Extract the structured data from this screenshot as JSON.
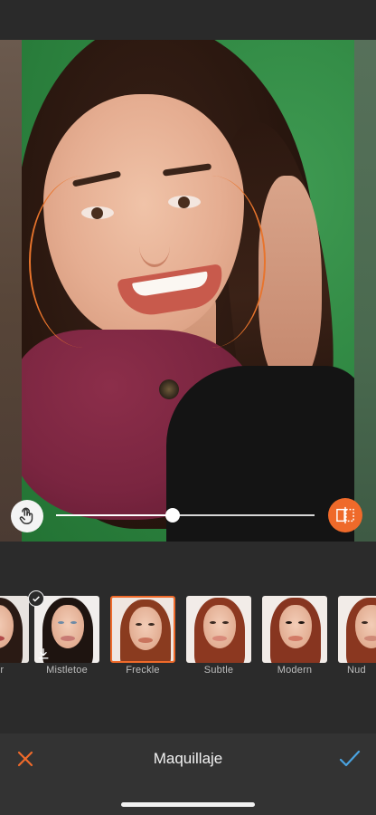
{
  "app": {
    "title": "Maquillaje"
  },
  "slider": {
    "value_fraction": 0.45
  },
  "colors": {
    "accent": "#ef6a2a",
    "confirm": "#4aa3e0",
    "background": "#2b2b2b"
  },
  "icons": {
    "touch": "touch-hand-icon",
    "compare": "compare-split-icon",
    "close": "close-icon",
    "confirm": "check-icon",
    "selected_badge": "check-circle-icon",
    "download": "download-icon"
  },
  "makeup_styles": [
    {
      "label": "der",
      "selected": false
    },
    {
      "label": "Mistletoe",
      "selected": false
    },
    {
      "label": "Freckle",
      "selected": true
    },
    {
      "label": "Subtle",
      "selected": false
    },
    {
      "label": "Modern",
      "selected": false
    },
    {
      "label": "Nud",
      "selected": false
    }
  ]
}
